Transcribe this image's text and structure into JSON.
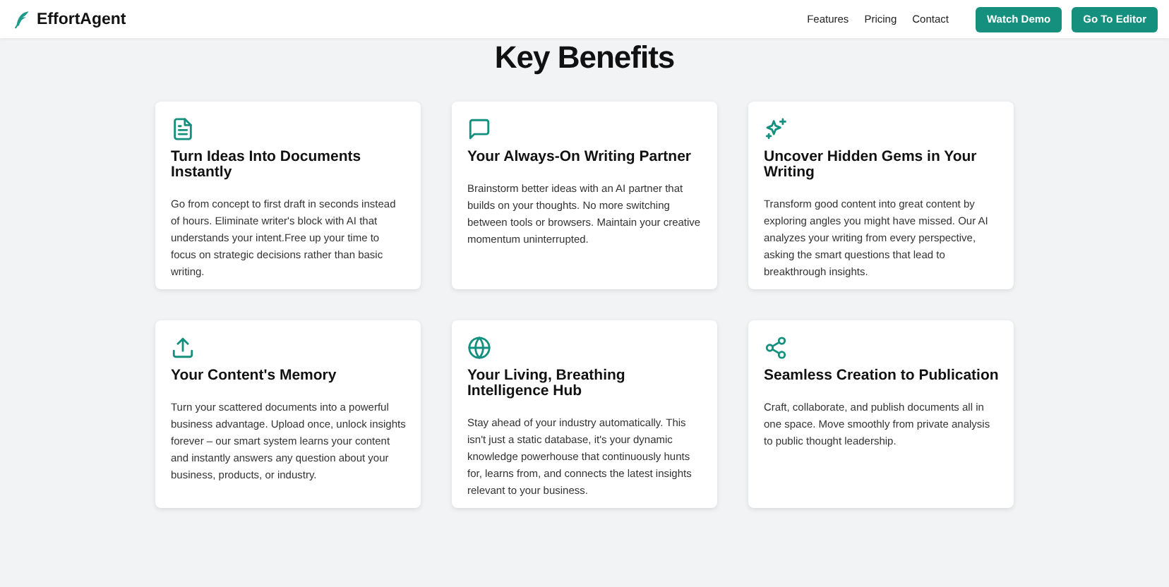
{
  "header": {
    "brand": "EffortAgent",
    "nav": [
      "Features",
      "Pricing",
      "Contact"
    ],
    "buttons": [
      "Watch Demo",
      "Go To Editor"
    ]
  },
  "section": {
    "title": "Key Benefits",
    "cards": [
      {
        "title": "Turn Ideas Into Documents Instantly",
        "text": "Go from concept to first draft in seconds instead of hours. Eliminate writer's block with AI that understands your intent.Free up your time to focus on strategic decisions rather than basic writing."
      },
      {
        "title": "Your Always-On Writing Partner",
        "text": "Brainstorm better ideas with an AI partner that builds on your thoughts. No more switching between tools or browsers. Maintain your creative momentum uninterrupted."
      },
      {
        "title": "Uncover Hidden Gems in Your Writing",
        "text": "Transform good content into great content by exploring angles you might have missed. Our AI analyzes your writing from every perspective, asking the smart questions that lead to breakthrough insights."
      },
      {
        "title": "Your Content's Memory",
        "text": "Turn your scattered documents into a powerful business advantage. Upload once, unlock insights forever – our smart system learns your content and instantly answers any question about your business, products, or industry."
      },
      {
        "title": "Your Living, Breathing Intelligence Hub",
        "text": "Stay ahead of your industry automatically. This isn't just a static database, it's your dynamic knowledge powerhouse that continuously hunts for, learns from, and connects the latest insights relevant to your business."
      },
      {
        "title": "Seamless Creation to Publication",
        "text": "Craft, collaborate, and publish documents all in one space. Move smoothly from private analysis to public thought leadership."
      }
    ]
  }
}
